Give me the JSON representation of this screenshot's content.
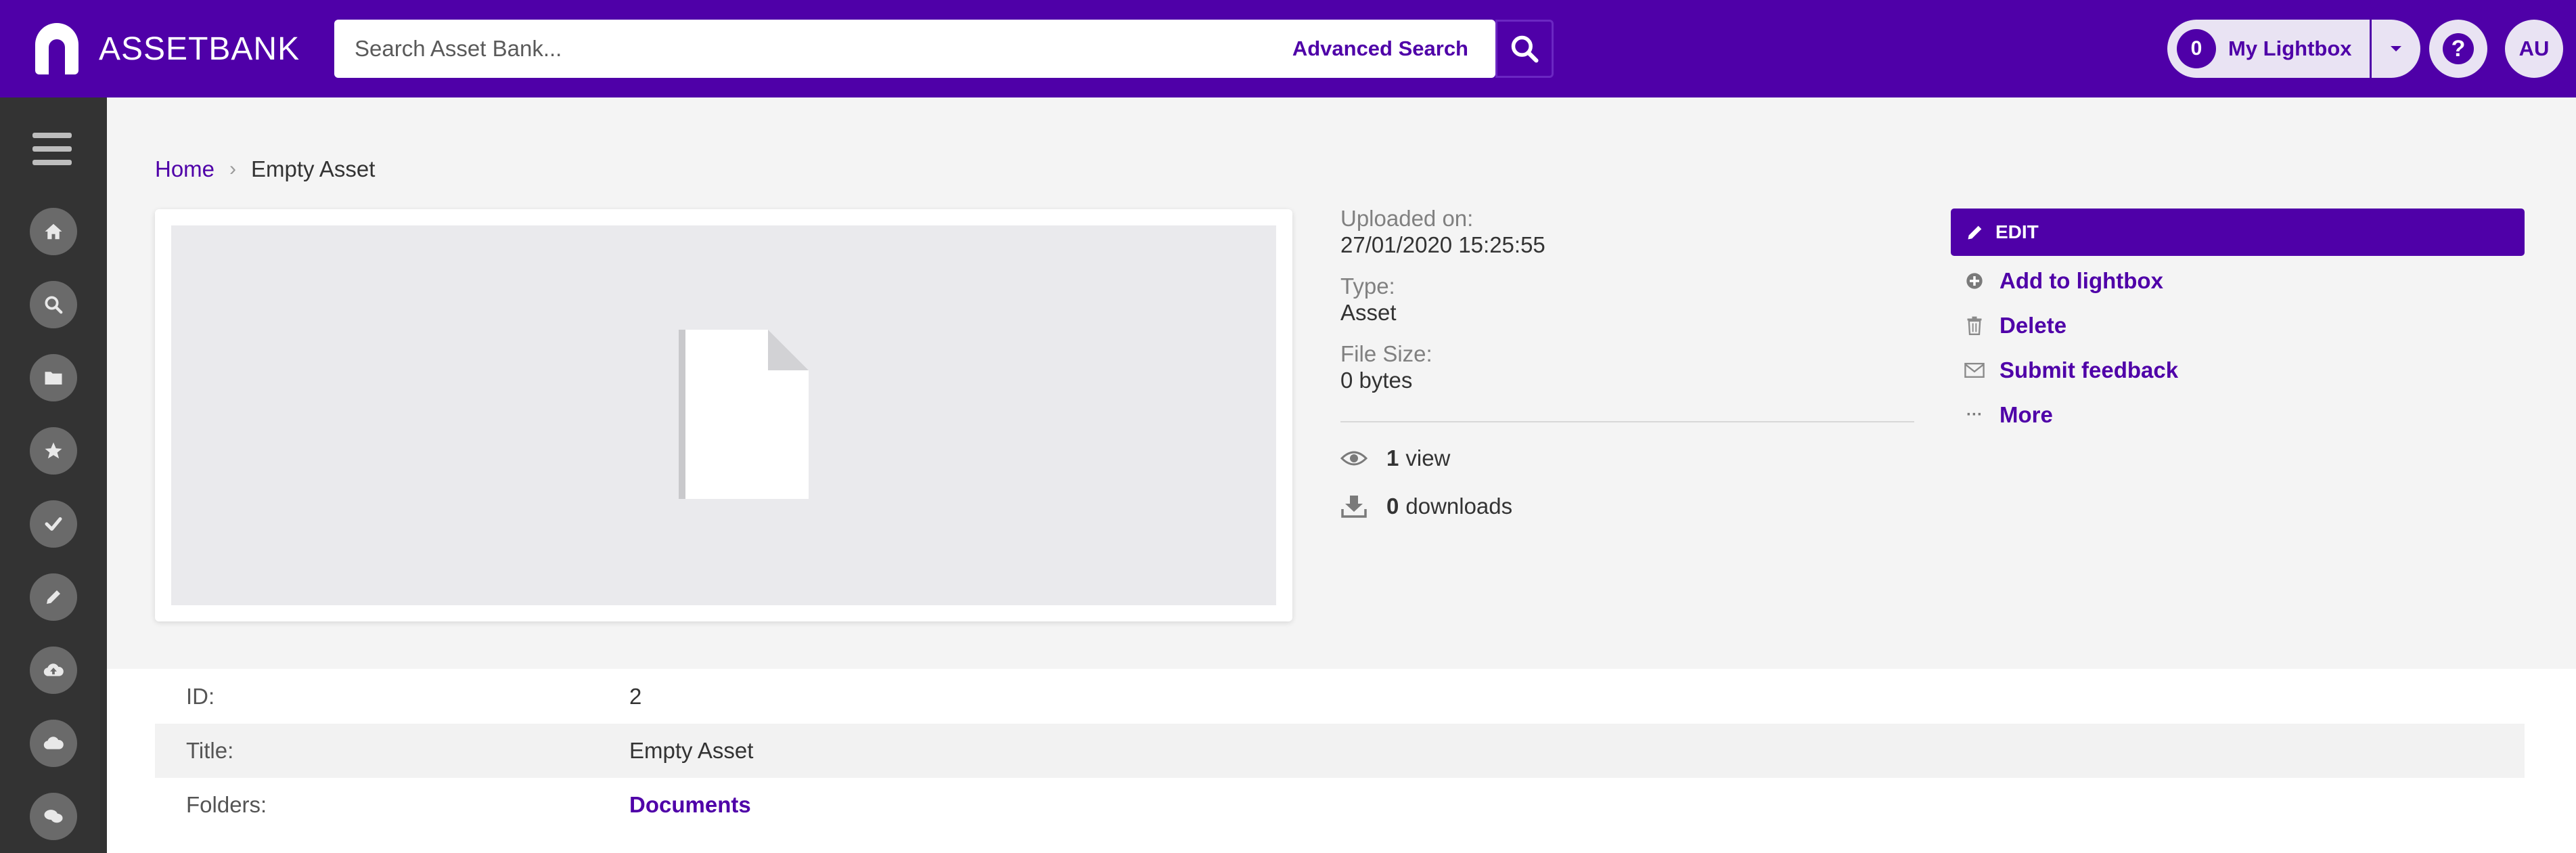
{
  "header": {
    "logo_text": "ASSETBANK",
    "search_placeholder": "Search Asset Bank...",
    "advanced_search_label": "Advanced Search",
    "lightbox_count": "0",
    "lightbox_label": "My Lightbox",
    "avatar_initials": "AU",
    "help_glyph": "?",
    "brand_color": "#4f00a8"
  },
  "sidebar": {
    "items": [
      {
        "name": "home-icon"
      },
      {
        "name": "search-icon"
      },
      {
        "name": "folder-icon"
      },
      {
        "name": "star-icon"
      },
      {
        "name": "check-icon"
      },
      {
        "name": "pencil-icon"
      },
      {
        "name": "upload-icon"
      },
      {
        "name": "cloud-icon"
      },
      {
        "name": "chat-icon"
      }
    ]
  },
  "breadcrumb": {
    "home": "Home",
    "separator": "›",
    "current": "Empty Asset"
  },
  "meta": {
    "uploaded_label": "Uploaded on:",
    "uploaded_value": "27/01/2020 15:25:55",
    "type_label": "Type:",
    "type_value": "Asset",
    "size_label": "File Size:",
    "size_value": "0 bytes",
    "views_count": "1",
    "views_label": "view",
    "downloads_count": "0",
    "downloads_label": "downloads"
  },
  "actions": {
    "edit": "EDIT",
    "add_to_lightbox": "Add to lightbox",
    "delete": "Delete",
    "submit_feedback": "Submit feedback",
    "more": "More",
    "more_glyph": "···"
  },
  "details": {
    "id_label": "ID:",
    "id_value": "2",
    "title_label": "Title:",
    "title_value": "Empty Asset",
    "folders_label": "Folders:",
    "folders_value": "Documents"
  }
}
